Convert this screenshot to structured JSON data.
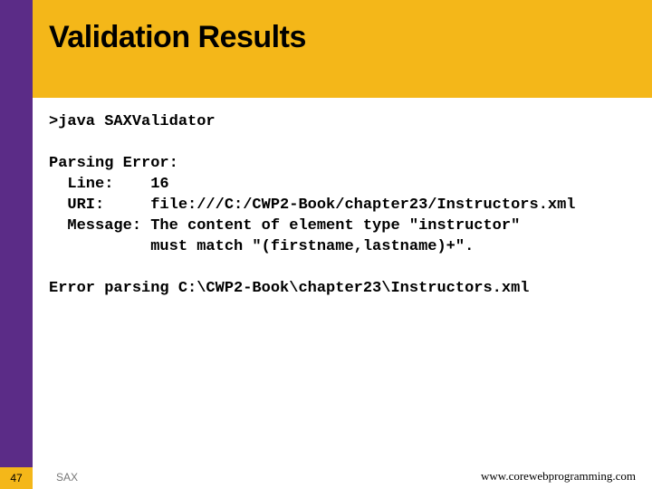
{
  "title": "Validation Results",
  "code": {
    "line1": ">java SAXValidator",
    "line2": "Parsing Error:",
    "line3": "  Line:    16",
    "line4": "  URI:     file:///C:/CWP2-Book/chapter23/Instructors.xml",
    "line5": "  Message: The content of element type \"instructor\"",
    "line6": "           must match \"(firstname,lastname)+\".",
    "line7": "Error parsing C:\\CWP2-Book\\chapter23\\Instructors.xml"
  },
  "footer": {
    "page": "47",
    "left": "SAX",
    "right": "www.corewebprogramming.com"
  }
}
